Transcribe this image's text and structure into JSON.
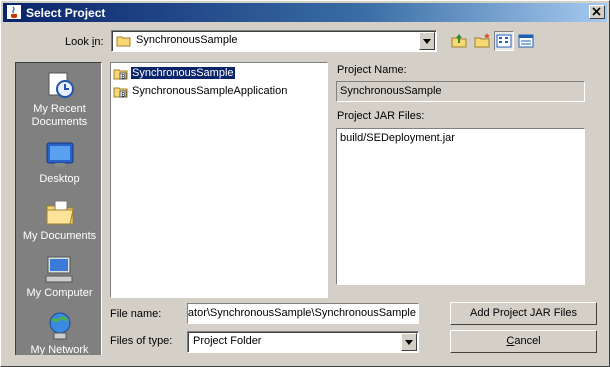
{
  "window": {
    "title": "Select Project",
    "app_icon": "java-cup-icon",
    "close_glyph": "✕"
  },
  "lookin": {
    "label_pre": "Look ",
    "label_key": "i",
    "label_post": "n:",
    "value": "SynchronousSample",
    "toolbar": [
      "up-folder-icon",
      "new-folder-icon",
      "list-view-icon",
      "details-view-icon"
    ]
  },
  "places": [
    {
      "label_line1": "My Recent",
      "label_line2": "Documents",
      "icon": "recent-documents-icon"
    },
    {
      "label_line1": "Desktop",
      "label_line2": "",
      "icon": "desktop-icon"
    },
    {
      "label_line1": "My Documents",
      "label_line2": "",
      "icon": "my-documents-icon"
    },
    {
      "label_line1": "My Computer",
      "label_line2": "",
      "icon": "my-computer-icon"
    },
    {
      "label_line1": "My Network",
      "label_line2": "",
      "icon": "my-network-icon"
    }
  ],
  "files": [
    {
      "label": "SynchronousSample",
      "selected": true,
      "icon": "project-folder-icon"
    },
    {
      "label": "SynchronousSampleApplication",
      "selected": false,
      "icon": "project-folder-icon"
    }
  ],
  "project_name": {
    "label": "Project Name:",
    "value": "SynchronousSample"
  },
  "project_jars": {
    "label": "Project JAR Files:",
    "items": [
      "build/SEDeployment.jar"
    ]
  },
  "file_name": {
    "label": "File name:",
    "value": "rator\\SynchronousSample\\SynchronousSample"
  },
  "files_of_type": {
    "label": "Files of type:",
    "value": "Project Folder"
  },
  "buttons": {
    "add_jar": "Add Project JAR Files",
    "cancel_key": "C",
    "cancel_rest": "ancel"
  }
}
